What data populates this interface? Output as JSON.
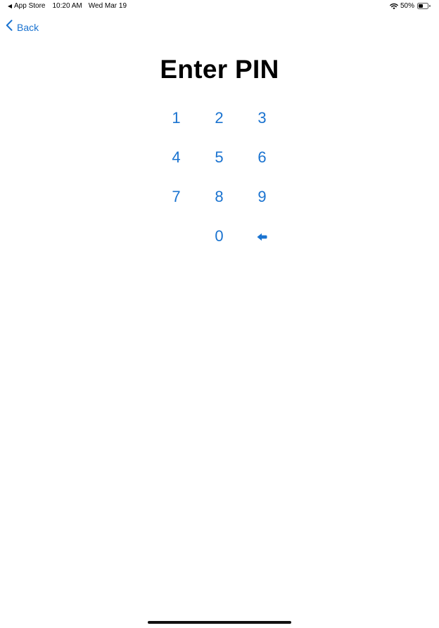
{
  "status_bar": {
    "back_app": "App Store",
    "time": "10:20 AM",
    "date": "Wed Mar 19",
    "battery_percent": "50%",
    "battery_level": 0.5
  },
  "nav": {
    "back_label": "Back",
    "back_icon": "chevron-left-icon"
  },
  "title": "Enter PIN",
  "keypad": {
    "keys": [
      "1",
      "2",
      "3",
      "4",
      "5",
      "6",
      "7",
      "8",
      "9",
      "",
      "0",
      "backspace"
    ],
    "backspace_icon": "backspace-arrow-icon"
  },
  "colors": {
    "accent": "#1a73d0",
    "text": "#000000",
    "background": "#ffffff"
  }
}
